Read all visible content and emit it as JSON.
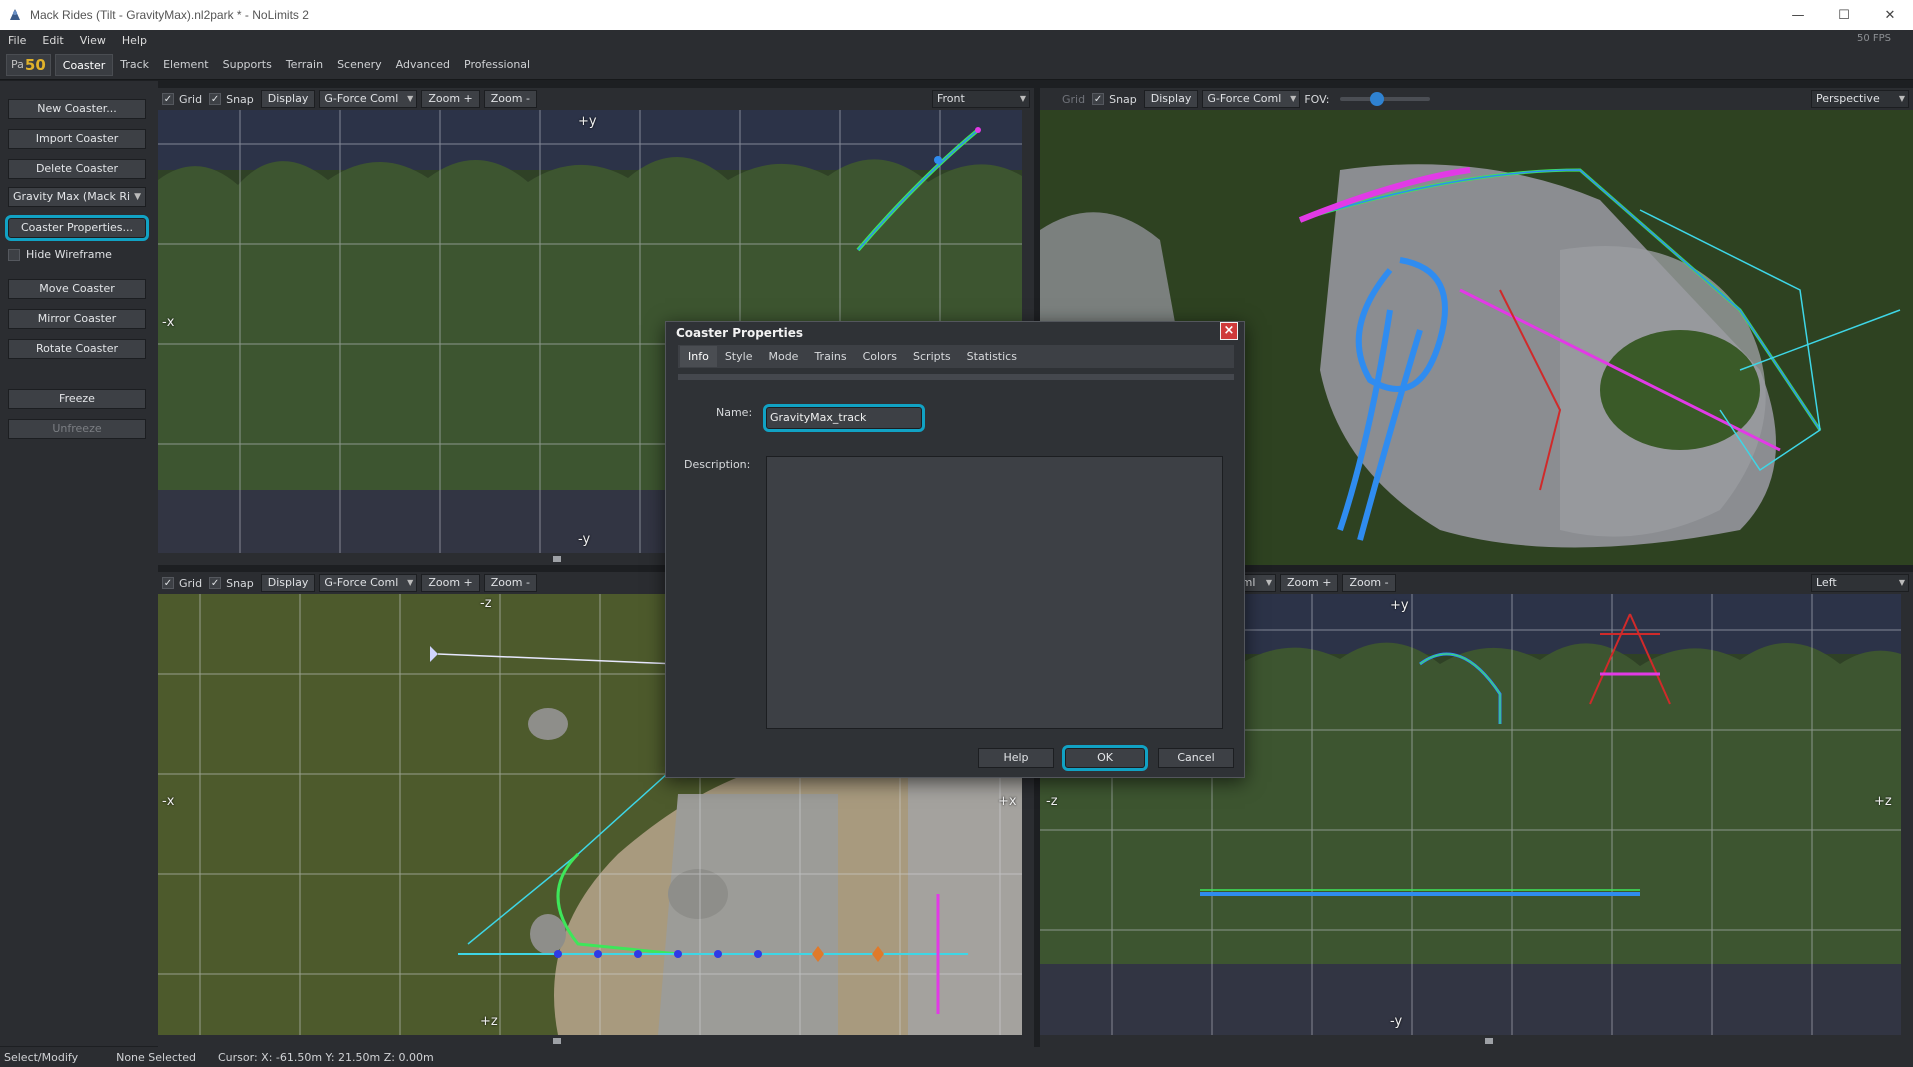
{
  "window": {
    "title": "Mack Rides (Tilt - GravityMax).nl2park * - NoLimits 2",
    "minimize": "—",
    "maximize": "☐",
    "close": "✕"
  },
  "menu": {
    "items": [
      "File",
      "Edit",
      "View",
      "Help"
    ],
    "fps": "50 FPS"
  },
  "tabs": {
    "park_prefix": "Pa",
    "park_badge": "50",
    "items": [
      "Coaster",
      "Track",
      "Element",
      "Supports",
      "Terrain",
      "Scenery",
      "Advanced",
      "Professional"
    ],
    "active": "Coaster"
  },
  "left_panel": {
    "new_coaster": "New Coaster...",
    "import_coaster": "Import Coaster",
    "delete_coaster": "Delete Coaster",
    "coaster_select": "Gravity Max (Mack Ri",
    "coaster_properties": "Coaster Properties...",
    "hide_wireframe": "Hide Wireframe",
    "move_coaster": "Move Coaster",
    "mirror_coaster": "Mirror Coaster",
    "rotate_coaster": "Rotate Coaster",
    "freeze": "Freeze",
    "unfreeze": "Unfreeze"
  },
  "viewports": {
    "toolbar": {
      "grid": "Grid",
      "snap": "Snap",
      "display": "Display",
      "gforce": "G-Force Coml",
      "zoom_in": "Zoom +",
      "zoom_out": "Zoom -",
      "fov": "FOV:"
    },
    "front": {
      "view": "Front",
      "top_axis": "+y",
      "bottom_axis": "-y",
      "left_axis": "-x"
    },
    "perspective": {
      "view": "Perspective"
    },
    "top": {
      "top_axis": "-z",
      "bottom_axis": "+z",
      "left_axis": "-x",
      "right_axis": "+x"
    },
    "left": {
      "view": "Left",
      "gforce_partial": "e Coml",
      "top_axis": "+y",
      "bottom_axis": "-y",
      "left_axis": "-z",
      "right_axis": "+z"
    }
  },
  "dialog": {
    "title": "Coaster Properties",
    "tabs": [
      "Info",
      "Style",
      "Mode",
      "Trains",
      "Colors",
      "Scripts",
      "Statistics"
    ],
    "active_tab": "Info",
    "name_label": "Name:",
    "name_value": "GravityMax_track",
    "description_label": "Description:",
    "description_value": "",
    "help": "Help",
    "ok": "OK",
    "cancel": "Cancel"
  },
  "status": {
    "mode": "Select/Modify",
    "selection": "None Selected",
    "cursor": "Cursor: X: -61.50m Y: 21.50m Z: 0.00m"
  },
  "colors": {
    "highlight": "#11a2c4",
    "track_blue": "#2f8cf0",
    "track_green": "#3ee65a",
    "track_magenta": "#e23ae6",
    "badge": "#e1b22a"
  }
}
